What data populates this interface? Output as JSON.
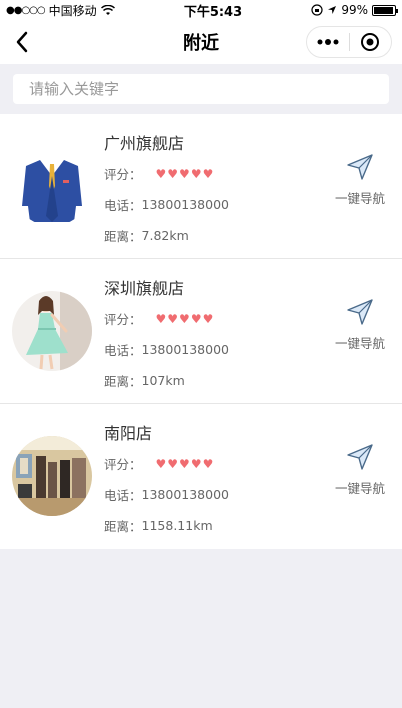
{
  "status_bar": {
    "carrier": "中国移动",
    "time": "下午5:43",
    "battery": "99%"
  },
  "nav": {
    "title": "附近"
  },
  "search": {
    "placeholder": "请输入关键字",
    "value": ""
  },
  "labels": {
    "rating": "评分：",
    "phone": "电话：",
    "distance": "距离：",
    "navigate": "一键导航"
  },
  "stores": [
    {
      "name": "广州旗舰店",
      "rating": 5,
      "phone": "13800138000",
      "distance": "7.82km",
      "image": "suit-jacket"
    },
    {
      "name": "深圳旗舰店",
      "rating": 5,
      "phone": "13800138000",
      "distance": "107km",
      "image": "woman-in-dress"
    },
    {
      "name": "南阳店",
      "rating": 5,
      "phone": "13800138000",
      "distance": "1158.11km",
      "image": "store-interior"
    }
  ],
  "colors": {
    "heart": "#f06c70",
    "background": "#efeff4",
    "suit": "#2d4fa3"
  }
}
